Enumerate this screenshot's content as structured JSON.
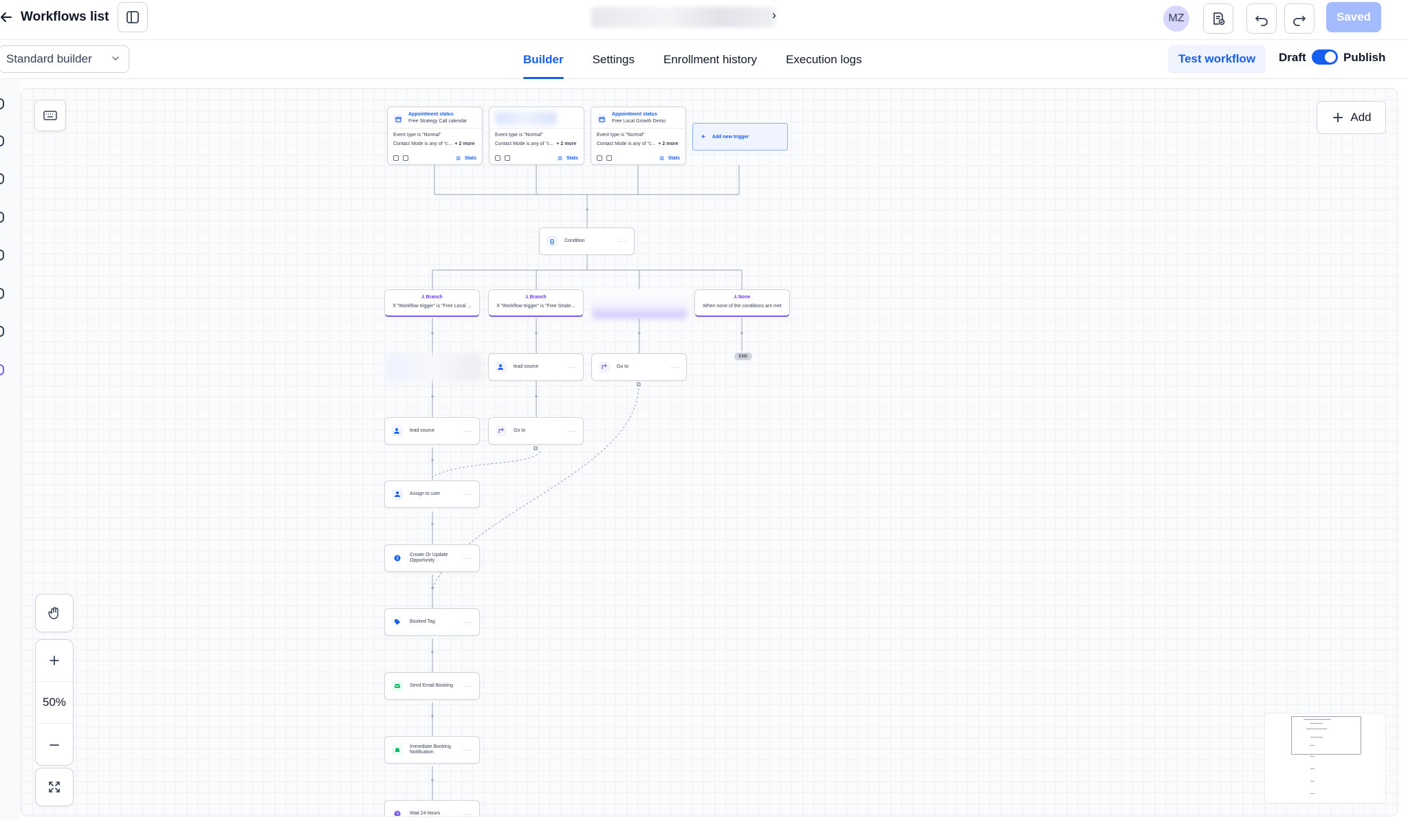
{
  "header": {
    "back_label": "Workflows list",
    "saved_label": "Saved",
    "avatar_initials": "MZ"
  },
  "subbar": {
    "builder_select": "Standard builder",
    "tabs": [
      {
        "label": "Builder",
        "active": true
      },
      {
        "label": "Settings",
        "active": false
      },
      {
        "label": "Enrollment history",
        "active": false
      },
      {
        "label": "Execution logs",
        "active": false
      }
    ],
    "test_workflow": "Test workflow",
    "draft_label": "Draft",
    "publish_label": "Publish",
    "publish_on": true
  },
  "canvas": {
    "add_label": "Add",
    "zoom_level": "50%",
    "triggers": [
      {
        "title": "Appointment status",
        "subtitle": "Free Strategy Call calendar",
        "line1": "Event type is \"Normal\"",
        "line2": "Contact Mode is any of \"c...",
        "more": "+ 2 more",
        "stats": "Stats"
      },
      {
        "title": "",
        "subtitle": "",
        "line1": "Event type is \"Normal\"",
        "line2": "Contact Mode is any of \"c...",
        "more": "+ 2 more",
        "stats": "Stats"
      },
      {
        "title": "Appointment status",
        "subtitle": "Free Local Growth Demo",
        "line1": "Event type is \"Normal\"",
        "line2": "Contact Mode is any of \"c...",
        "more": "+ 2 more",
        "stats": "Stats"
      }
    ],
    "add_trigger": "Add new trigger",
    "condition_label": "Condition",
    "branches": [
      {
        "title": "Branch",
        "desc": "If \"Workflow trigger\" is \"Free Local ..."
      },
      {
        "title": "Branch",
        "desc": "If \"Workflow trigger\" is \"Free Strate..."
      },
      {
        "title": "None",
        "desc": "When none of the conditions are met"
      }
    ],
    "end_label": "END",
    "actions": {
      "lead_source_b2": "lead source",
      "goto_b3": "Go to",
      "lead_source_b1": "lead source",
      "goto_b2": "Go to",
      "assign_user": "Assign to user",
      "opportunity": "Create Or Update Opportunity",
      "booked_tag": "Booked Tag",
      "send_email": "Send Email Booking",
      "notification": "Immediate Booking Notification",
      "wait": "Wait 24 Hours"
    }
  },
  "colors": {
    "accent": "#155eef",
    "branch": "#7a5af8",
    "saved_button": "#a4bcfd"
  }
}
